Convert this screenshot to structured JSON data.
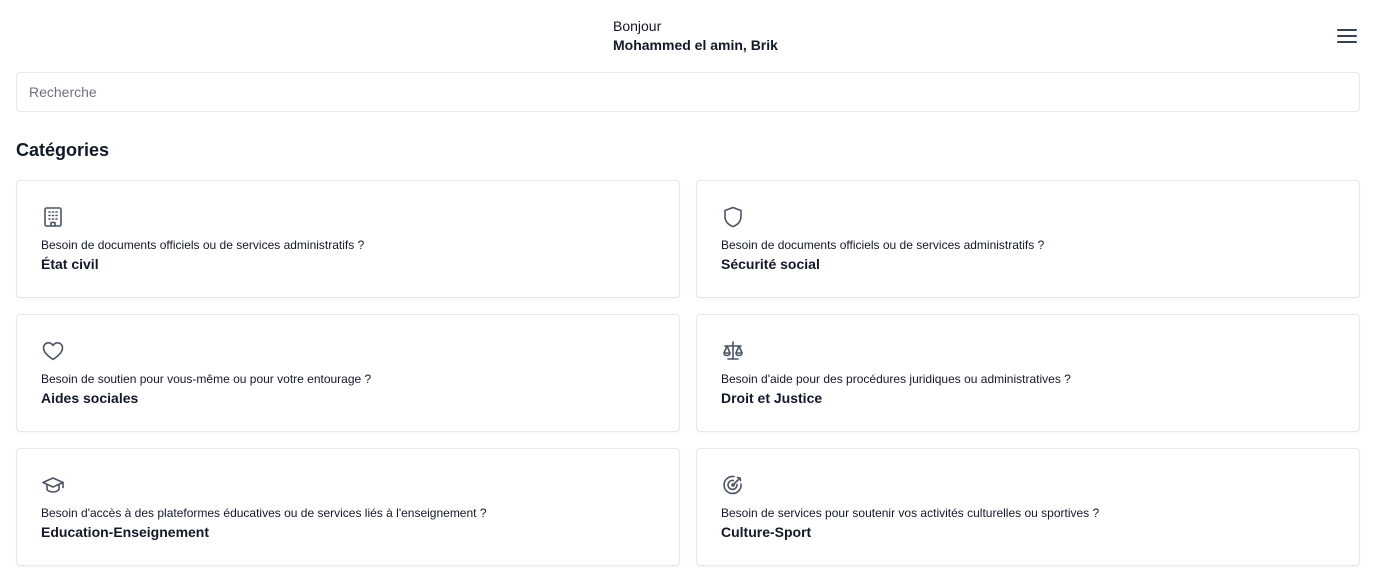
{
  "header": {
    "greeting": "Bonjour",
    "user_name": "Mohammed el amin, Brik",
    "menu_icon": "hamburger-menu-icon"
  },
  "search": {
    "placeholder": "Recherche",
    "value": ""
  },
  "categories": {
    "title": "Catégories",
    "items": [
      {
        "icon": "building-icon",
        "description": "Besoin de documents officiels ou de services administratifs ?",
        "label": "État civil"
      },
      {
        "icon": "shield-icon",
        "description": "Besoin de documents officiels ou de services administratifs ?",
        "label": "Sécurité social"
      },
      {
        "icon": "heart-icon",
        "description": "Besoin de soutien pour vous-même ou pour votre entourage ?",
        "label": "Aides sociales"
      },
      {
        "icon": "scale-icon",
        "description": "Besoin d'aide pour des procédures juridiques ou administratives ?",
        "label": "Droit et Justice"
      },
      {
        "icon": "graduation-cap-icon",
        "description": "Besoin d'accès à des plateformes éducatives ou de services liés à l'enseignement ?",
        "label": "Education-Enseignement"
      },
      {
        "icon": "target-icon",
        "description": "Besoin de services pour soutenir vos activités culturelles ou sportives ?",
        "label": "Culture-Sport"
      }
    ]
  },
  "colors": {
    "text": "#111827",
    "border": "#e5e7eb",
    "icon": "#4b5563",
    "placeholder": "#6b7280"
  }
}
